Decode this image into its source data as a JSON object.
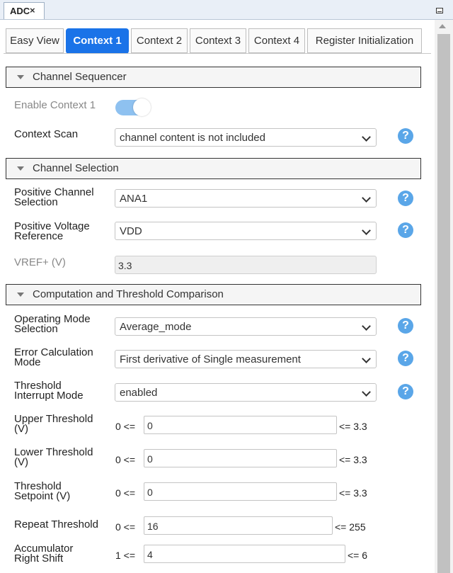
{
  "window": {
    "tab_title": "ADC",
    "tab_close": "×"
  },
  "tabs": [
    "Easy View",
    "Context 1",
    "Context 2",
    "Context 3",
    "Context 4",
    "Register Initialization"
  ],
  "active_tab": "Context 1",
  "help_glyph": "?",
  "sections": {
    "channel_sequencer": {
      "title": "Channel Sequencer",
      "enable_label": "Enable Context 1",
      "enable_on": true,
      "context_scan_label": "Context Scan",
      "context_scan_value": "channel content is not included"
    },
    "channel_selection": {
      "title": "Channel Selection",
      "positive_channel_label_1": "Positive Channel",
      "positive_channel_label_2": "Selection",
      "positive_channel_value": "ANA1",
      "positive_vref_label_1": "Positive Voltage",
      "positive_vref_label_2": "Reference",
      "positive_vref_value": "VDD",
      "vref_plus_label": "VREF+ (V)",
      "vref_plus_value": "3.3"
    },
    "computation": {
      "title": "Computation and Threshold Comparison",
      "operating_mode_label_1": "Operating Mode",
      "operating_mode_label_2": "Selection",
      "operating_mode_value": "Average_mode",
      "error_calc_label_1": "Error Calculation",
      "error_calc_label_2": "Mode",
      "error_calc_value": "First derivative of Single measurement",
      "threshold_int_label_1": "Threshold",
      "threshold_int_label_2": "Interrupt Mode",
      "threshold_int_value": "enabled",
      "upper": {
        "label_1": "Upper Threshold",
        "label_2": "(V)",
        "pre": "0 <=",
        "value": "0",
        "post": "<= 3.3"
      },
      "lower": {
        "label_1": "Lower Threshold",
        "label_2": "(V)",
        "pre": "0 <=",
        "value": "0",
        "post": "<= 3.3"
      },
      "setpoint": {
        "label_1": "Threshold",
        "label_2": "Setpoint (V)",
        "pre": "0 <=",
        "value": "0",
        "post": "<= 3.3"
      },
      "repeat": {
        "label_1": "Repeat Threshold",
        "pre": "0 <=",
        "value": "16",
        "post": "<= 255"
      },
      "accum": {
        "label_1": "Accumulator",
        "label_2": "Right Shift",
        "pre": "1 <=",
        "value": "4",
        "post": "<= 6"
      }
    }
  },
  "colors": {
    "accent": "#1a73e8",
    "help": "#5aa6e8",
    "toggle": "#8ec1f0"
  }
}
